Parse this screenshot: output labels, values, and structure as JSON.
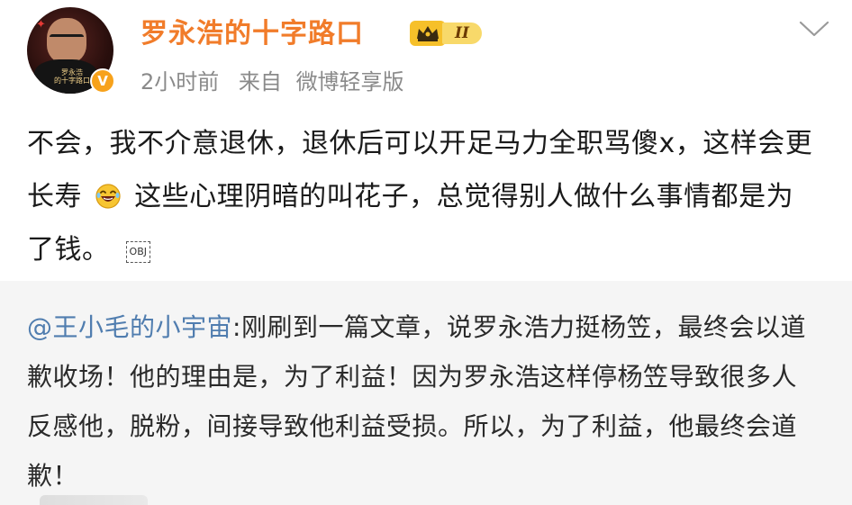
{
  "post": {
    "author": "罗永浩的十字路口",
    "avatar_logo_text": "罗永浩\n的十字路口",
    "verified_badge": "V",
    "vip_level": "II",
    "time": "2小时前",
    "source_label": "来自",
    "source_app": "微博轻享版",
    "content_part1": "不会，我不介意退休，退休后可以开足马力全职骂傻x，这样会更长寿",
    "content_part2": " 这些心理阴暗的叫花子，总觉得别人做什么事情都是为了钱。",
    "obj_marker": "OBJ"
  },
  "icons": {
    "menu": "chevron-down-icon",
    "emoji": "laughing-emoji-icon",
    "vip": "crown-icon"
  },
  "repost": {
    "user": "@王小毛的小宇宙",
    "text": ":刚刷到一篇文章，说罗永浩力挺杨笠，最终会以道歉收场！他的理由是，为了利益！因为罗永浩这样停杨笠导致很多人反感他，脱粉，间接导致他利益受损。所以，为了利益，他最终会道歉！"
  },
  "colors": {
    "username": "#f17c2a",
    "meta": "#8a8a8a",
    "link": "#507daf",
    "repost_bg": "#f5f5f5",
    "vip_gold": "#f6c02a",
    "verified_orange": "#f7a21b"
  }
}
